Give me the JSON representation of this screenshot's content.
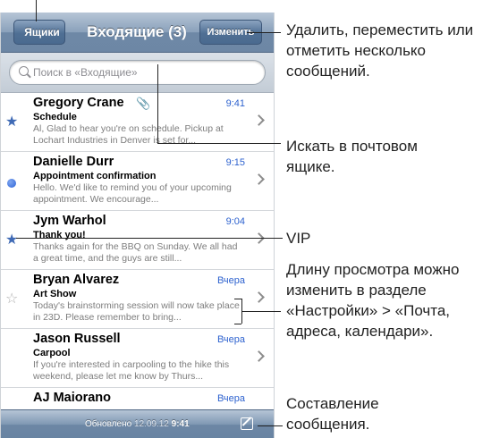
{
  "nav": {
    "back_label": "Ящики",
    "title": "Входящие (3)",
    "edit_label": "Изменить"
  },
  "search": {
    "placeholder": "Поиск в «Входящие»"
  },
  "messages": [
    {
      "sender": "Gregory Crane",
      "time": "9:41",
      "subject": "Schedule",
      "preview": "Al, Glad to hear you're on schedule. Pickup at Lochart Industries in Denver is set for...",
      "marker": "star-filled",
      "attachment": true
    },
    {
      "sender": "Danielle Durr",
      "time": "9:15",
      "subject": "Appointment confirmation",
      "preview": "Hello. We'd like to remind you of your upcoming appointment. We encourage...",
      "marker": "unread-dot"
    },
    {
      "sender": "Jym Warhol",
      "time": "9:04",
      "subject": "Thank you!",
      "preview": "Thanks again for the BBQ on Sunday. We all had a great time, and the guys are still...",
      "marker": "star-filled"
    },
    {
      "sender": "Bryan Alvarez",
      "time": "Вчера",
      "subject": "Art Show",
      "preview": "Today's brainstorming session will now take place in 23D. Please remember to bring...",
      "marker": "star-empty"
    },
    {
      "sender": "Jason Russell",
      "time": "Вчера",
      "subject": "Carpool",
      "preview": "If you're interested in carpooling to the hike this weekend, please let me know by Thurs...",
      "marker": "none"
    },
    {
      "sender": "AJ Maiorano",
      "time": "Вчера",
      "subject": "",
      "preview": "",
      "marker": "none"
    }
  ],
  "toolbar": {
    "updated_label": "Обновлено",
    "updated_date": "12.09.12",
    "updated_time": "9:41"
  },
  "callouts": {
    "edit": "Удалить, переместить или отметить несколько сообщений.",
    "search": "Искать в почтовом ящике.",
    "vip": "VIP",
    "preview_length": "Длину просмотра можно изменить в разделе «Настройки» > «Почта, адреса, календари».",
    "compose": "Составление сообщения."
  },
  "colors": {
    "accent": "#2d62cf",
    "star": "#3f6ab5",
    "navbar": "#6d87a5"
  }
}
